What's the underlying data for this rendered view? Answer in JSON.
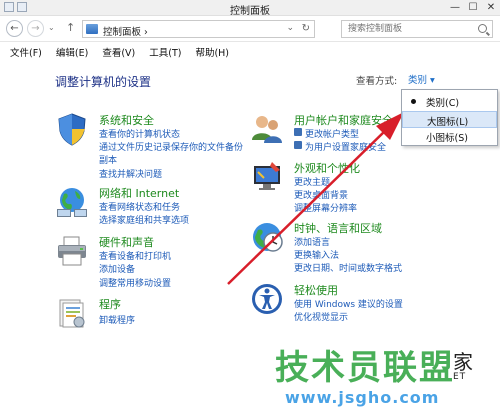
{
  "window": {
    "title": "控制面板",
    "min": "—",
    "max": "☐",
    "close": "✕"
  },
  "address": {
    "back": "←",
    "forward": "→",
    "up": "↑",
    "crumb": "控制面板  ›",
    "dropdown": "⌄",
    "refresh": "↻"
  },
  "search": {
    "placeholder": "搜索控制面板"
  },
  "menu": [
    "文件(F)",
    "编辑(E)",
    "查看(V)",
    "工具(T)",
    "帮助(H)"
  ],
  "content": {
    "heading": "调整计算机的设置",
    "view_by_label": "查看方式:",
    "view_by_value": "类别 ▾"
  },
  "categories": [
    {
      "title": "系统和安全",
      "links": [
        "查看你的计算机状态",
        "通过文件历史记录保存你的文件备份",
        "副本",
        "查找并解决问题"
      ]
    },
    {
      "title": "网络和 Internet",
      "links": [
        "查看网络状态和任务",
        "选择家庭组和共享选项"
      ]
    },
    {
      "title": "硬件和声音",
      "links": [
        "查看设备和打印机",
        "添加设备",
        "调整常用移动设置"
      ]
    },
    {
      "title": "程序",
      "links": [
        "卸载程序"
      ]
    },
    {
      "title": "用户帐户和家庭安全",
      "links": [
        "更改帐户类型",
        "为用户设置家庭安全"
      ]
    },
    {
      "title": "外观和个性化",
      "links": [
        "更改主题",
        "更改桌面背景",
        "调整屏幕分辨率"
      ]
    },
    {
      "title": "时钟、语言和区域",
      "links": [
        "添加语言",
        "更换输入法",
        "更改日期、时间或数字格式"
      ]
    },
    {
      "title": "轻松使用",
      "links": [
        "使用 Windows 建议的设置",
        "优化视觉显示"
      ]
    }
  ],
  "dropdown": {
    "items": [
      "类别(C)",
      "大图标(L)",
      "小图标(S)"
    ],
    "selected": 0,
    "hover": 1
  },
  "watermark": {
    "big": "技术员联盟",
    "jia": "家",
    "net": "ET",
    "url": "www.jsgho.com"
  },
  "colors": {
    "accent": "#1e6ec8",
    "category_title": "#1e8a1e",
    "link": "#1e5bb8",
    "heading": "#1e3287",
    "arrow": "#d81e2a"
  },
  "icons": [
    "shield-icon",
    "network-globe-icon",
    "printer-icon",
    "programs-icon",
    "users-icon",
    "paint-monitor-icon",
    "clock-globe-icon",
    "ease-of-access-icon"
  ]
}
